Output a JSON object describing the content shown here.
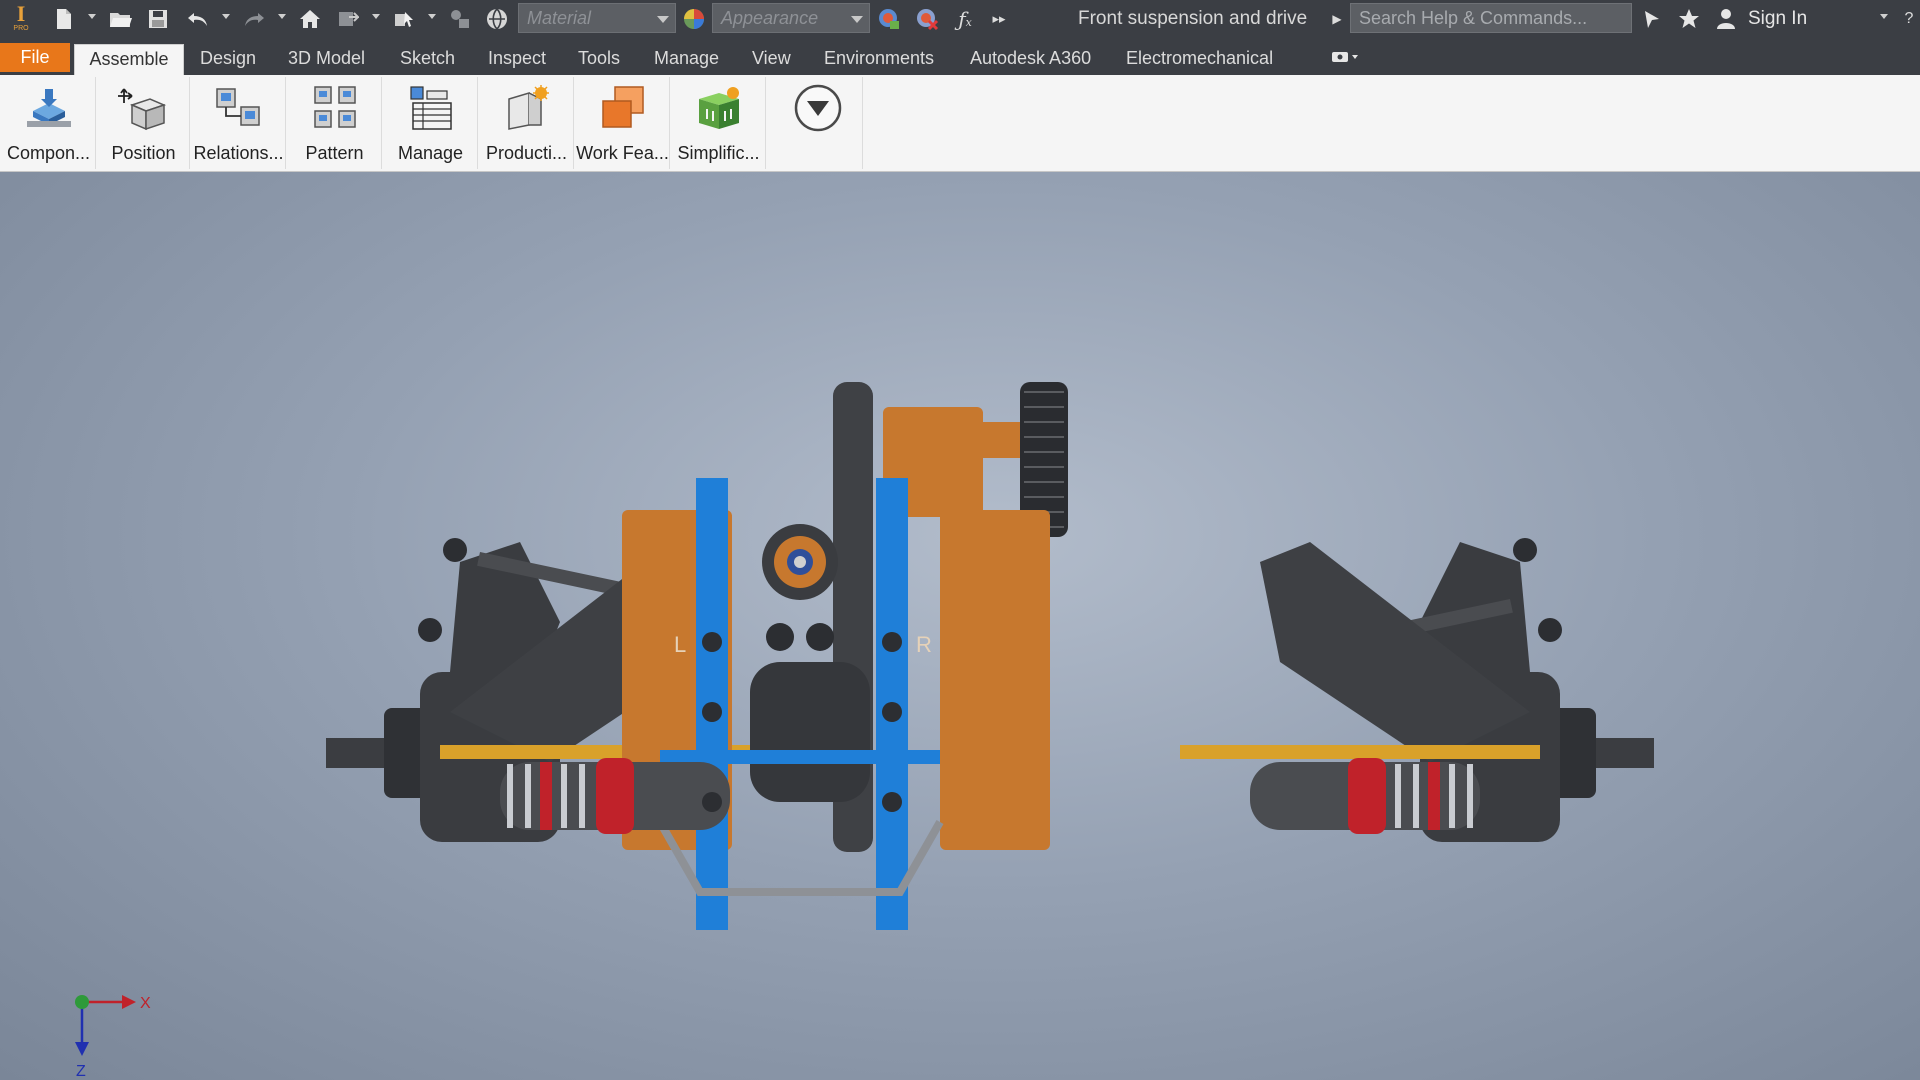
{
  "app": {
    "name": "Autodesk Inventor Professional",
    "logo_glyph": "I",
    "logo_sub": "PRO"
  },
  "quick_access": {
    "material_placeholder": "Material",
    "appearance_placeholder": "Appearance",
    "document_title": "Front suspension and drive",
    "search_placeholder": "Search Help & Commands...",
    "sign_in": "Sign In",
    "icons": [
      "new-icon",
      "open-icon",
      "save-icon",
      "undo-icon",
      "redo-icon",
      "home-icon",
      "return-icon",
      "select-priority-icon",
      "measure-icon",
      "update-icon",
      "appearance-sphere-icon",
      "adjust-appearance-icon",
      "clear-appearance-icon",
      "parameters-fx-icon",
      "more-icon",
      "comm-center-icon",
      "favorites-icon",
      "user-icon"
    ]
  },
  "tabs": [
    "File",
    "Assemble",
    "Design",
    "3D Model",
    "Sketch",
    "Inspect",
    "Tools",
    "Manage",
    "View",
    "Environments",
    "Autodesk A360",
    "Electromechanical"
  ],
  "active_tab": "Assemble",
  "ribbon": {
    "buttons": [
      {
        "label": "Compon...",
        "icon": "place-component-icon"
      },
      {
        "label": "Position",
        "icon": "position-move-icon"
      },
      {
        "label": "Relations...",
        "icon": "relationships-constrain-icon"
      },
      {
        "label": "Pattern",
        "icon": "pattern-icon"
      },
      {
        "label": "Manage",
        "icon": "bill-of-materials-icon"
      },
      {
        "label": "Producti...",
        "icon": "productivity-icon"
      },
      {
        "label": "Work Fea...",
        "icon": "work-features-icon"
      },
      {
        "label": "Simplific...",
        "icon": "simplification-icon"
      }
    ],
    "expand_icon": "ribbon-expand-icon"
  },
  "viewport": {
    "model_name": "Front suspension and drive",
    "mount_labels": {
      "left": "L",
      "right": "R"
    },
    "triad": {
      "x_label": "X",
      "z_label": "Z"
    },
    "colors": {
      "frame_blue": "#1f7fd8",
      "bracket_orange": "#c7782e",
      "arm_dark": "#3a3c40",
      "shock_red": "#c0222a",
      "rod_gold": "#d9a12a",
      "spring_silver": "#c9ccd1"
    }
  },
  "accent": {
    "file_tab": "#e8771a"
  }
}
